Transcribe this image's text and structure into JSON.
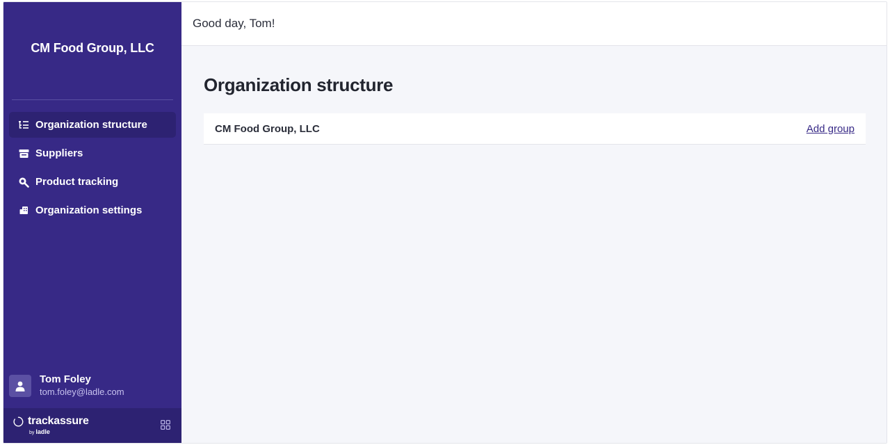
{
  "sidebar": {
    "org_name": "CM Food Group, LLC",
    "items": [
      {
        "label": "Organization structure",
        "icon": "tree-list-icon",
        "active": true
      },
      {
        "label": "Suppliers",
        "icon": "store-icon",
        "active": false
      },
      {
        "label": "Product tracking",
        "icon": "search-icon",
        "active": false
      },
      {
        "label": "Organization settings",
        "icon": "building-icon",
        "active": false
      }
    ],
    "user": {
      "name": "Tom Foley",
      "email": "tom.foley@ladle.com"
    },
    "brand": {
      "name": "trackassure",
      "by_prefix": "by",
      "by_name": "ladle"
    }
  },
  "header": {
    "greeting": "Good day, Tom!"
  },
  "main": {
    "title": "Organization structure",
    "org_row": {
      "name": "CM Food Group, LLC",
      "action_label": "Add group"
    }
  },
  "colors": {
    "sidebar": "#372986",
    "sidebar_active": "#2d2272",
    "background": "#f5f6fa",
    "link": "#372986"
  }
}
